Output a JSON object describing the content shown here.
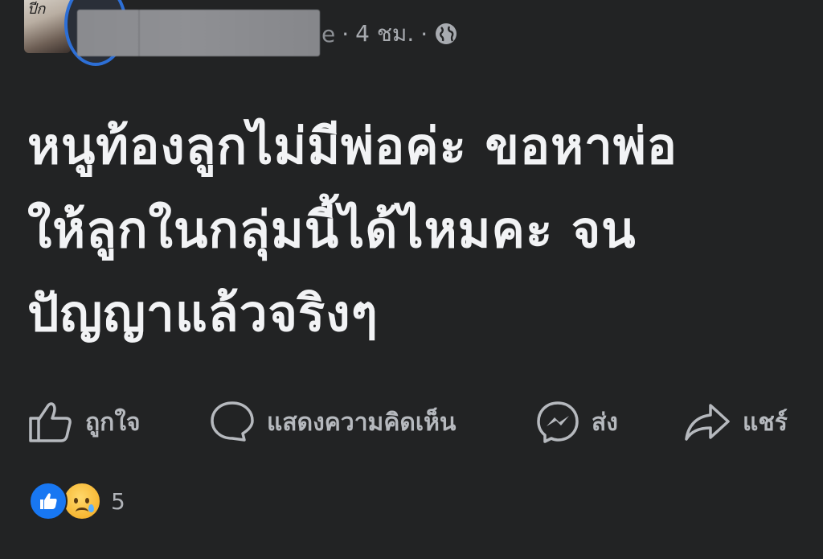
{
  "post": {
    "meta": {
      "name_fragment": "e",
      "separator": "·",
      "timestamp": "4 ชม.",
      "privacy_icon": "globe-icon"
    },
    "avatar_text": "ปีก",
    "content_lines": [
      "หนูท้องลูกไม่มีพ่อค่ะ ขอหาพ่อ",
      "ให้ลูกในกลุ่มนี้ได้ไหมคะ จน",
      "ปัญญาแล้วจริงๆ"
    ],
    "actions": {
      "like": {
        "label": "ถูกใจ",
        "icon": "thumbs-up-icon"
      },
      "comment": {
        "label": "แสดงความคิดเห็น",
        "icon": "comment-icon"
      },
      "send": {
        "label": "ส่ง",
        "icon": "messenger-icon"
      },
      "share": {
        "label": "แชร์",
        "icon": "share-icon"
      }
    },
    "reactions": {
      "types": [
        "like",
        "sad"
      ],
      "count": "5"
    }
  },
  "colors": {
    "background": "#222324",
    "text_primary": "#f2f3f5",
    "text_secondary": "#b6b9be",
    "like_blue": "#1877f2",
    "ring_blue": "#2d6fd6"
  }
}
